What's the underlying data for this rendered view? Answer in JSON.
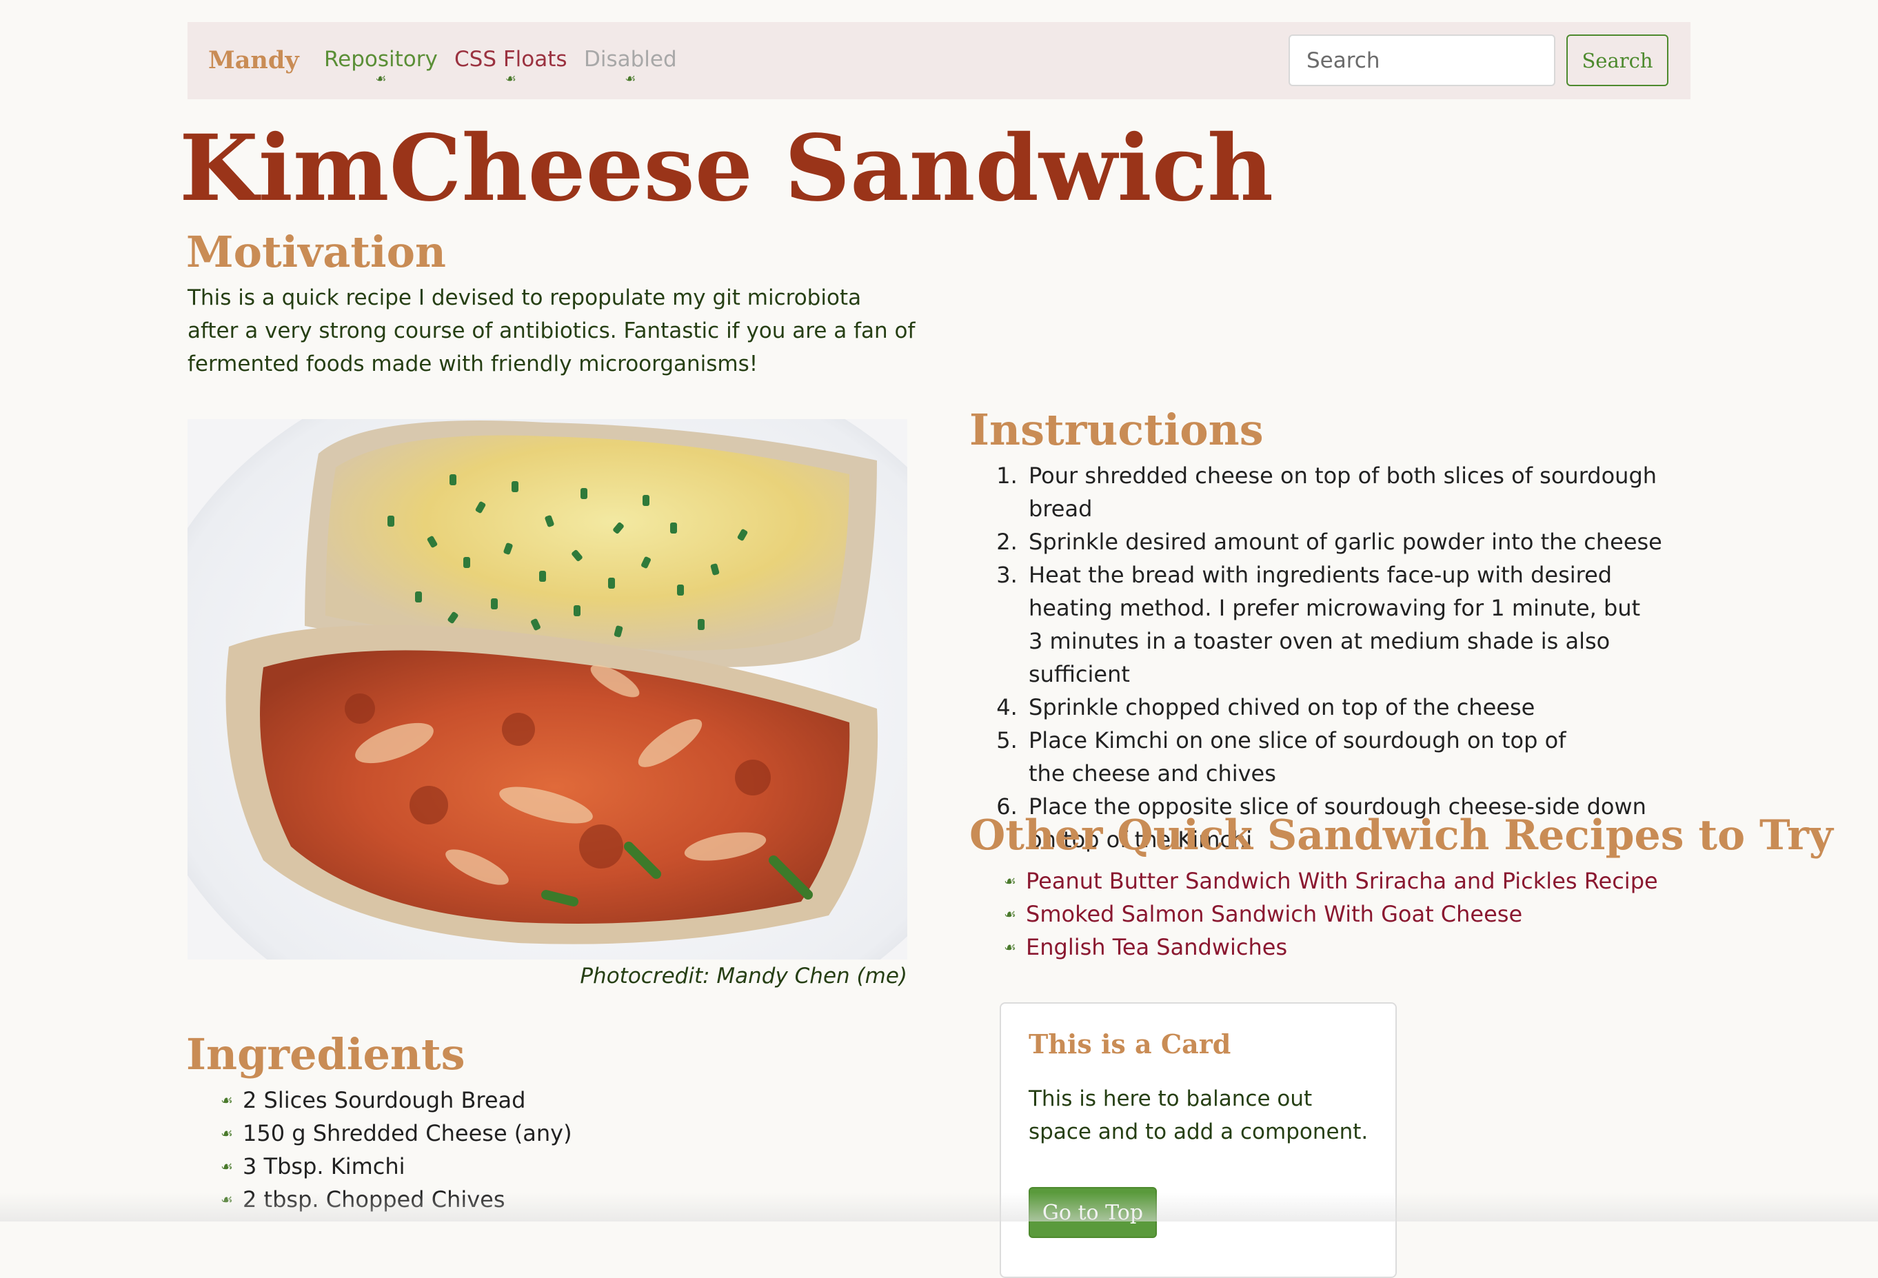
{
  "nav": {
    "brand": "Mandy",
    "links": [
      {
        "label": "Repository"
      },
      {
        "label": "CSS Floats"
      },
      {
        "label": "Disabled"
      }
    ],
    "leaf_glyph": "☙",
    "search_placeholder": "Search",
    "search_button": "Search"
  },
  "page": {
    "title": "KimCheese Sandwich"
  },
  "motivation": {
    "heading": "Motivation",
    "text": "This is a quick recipe I devised to repopulate my git microbiota after a very strong course of antibiotics. Fantastic if you are a fan of fermented foods made with friendly microorganisms!"
  },
  "photo": {
    "caption": "Photocredit: Mandy Chen (me)"
  },
  "instructions": {
    "heading": "Instructions",
    "steps": [
      "Pour shredded cheese on top of both slices of sourdough bread",
      "Sprinkle desired amount of garlic powder into the cheese",
      "Heat the bread with ingredients face-up with desired heating method. I prefer microwaving for 1 minute, but 3 minutes in a toaster oven at medium shade is also sufficient",
      "Sprinkle chopped chived on top of the cheese",
      "Place Kimchi on one slice of sourdough on top of the cheese and chives",
      "Place the opposite slice of sourdough cheese-side down on top of the Kimchi"
    ]
  },
  "other_recipes": {
    "heading": "Other Quick Sandwich Recipes to Try",
    "links": [
      "Peanut Butter Sandwich With Sriracha and Pickles Recipe",
      "Smoked Salmon Sandwich With Goat Cheese",
      "English Tea Sandwiches"
    ]
  },
  "ingredients": {
    "heading": "Ingredients",
    "items": [
      "2 Slices Sourdough Bread",
      "150 g Shredded Cheese (any)",
      "3 Tbsp. Kimchi",
      "2 tbsp. Chopped Chives"
    ]
  },
  "card": {
    "title": "This is a Card",
    "text": "This is here to balance out space and to add a component.",
    "button": "Go to Top"
  },
  "colors": {
    "brand": "#c98c55",
    "title": "#9a3419",
    "nav_bg": "#f2e9e8",
    "link_green": "#5b8f37",
    "link_red": "#9b3240",
    "recipe_link": "#8a1830",
    "button_green": "#5a9a3c"
  }
}
